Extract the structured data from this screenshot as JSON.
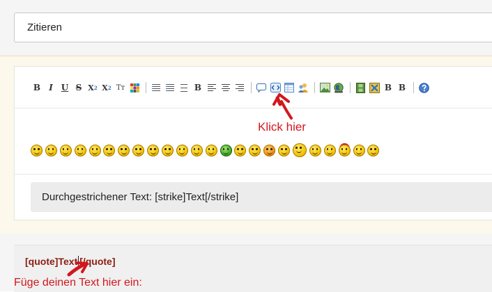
{
  "quote_button": {
    "label": "Zitieren"
  },
  "toolbar": {
    "bold": "B",
    "italic": "I",
    "underline": "U",
    "strike": "S",
    "subscript": "X",
    "subscript_mark": "2",
    "superscript": "X",
    "superscript_mark": "2",
    "font_size": "Tт",
    "heading": "B",
    "bold2": "B",
    "bold3": "B"
  },
  "annotations": {
    "click_here": "Klick hier",
    "insert_text": "Füge deinen Text hier ein:"
  },
  "preview": {
    "text": "Durchgestrichener Text: [strike]Text[/strike]"
  },
  "textarea": {
    "before_caret": "[quote]Text",
    "after_caret": "[/quote]"
  },
  "colors": {
    "annotation_red": "#d2171d",
    "quote_text": "#8b1d12",
    "editor_band": "#fdf8ec"
  }
}
